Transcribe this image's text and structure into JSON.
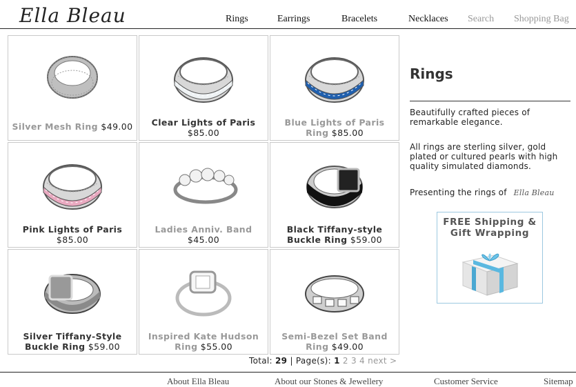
{
  "brand": {
    "logo": "Ella Bleau"
  },
  "nav": {
    "items": [
      "Rings",
      "Earrings",
      "Bracelets",
      "Necklaces"
    ],
    "search": "Search",
    "bag": "Shopping Bag"
  },
  "products": [
    {
      "name": "Silver Mesh Ring",
      "price": "$49.00",
      "style": "mesh",
      "muted": true
    },
    {
      "name": "Clear Lights of Paris",
      "price": "$85.00",
      "style": "clear",
      "muted": false
    },
    {
      "name": "Blue Lights of Paris Ring",
      "price": "$85.00",
      "style": "blue",
      "muted": true
    },
    {
      "name": "Pink Lights of Paris",
      "price": "$85.00",
      "style": "pink",
      "muted": false
    },
    {
      "name": "Ladies Anniv. Band",
      "price": "$45.00",
      "style": "anniv",
      "muted": true
    },
    {
      "name": "Black Tiffany-style Buckle Ring",
      "price": "$59.00",
      "style": "buckle-black",
      "muted": false
    },
    {
      "name": "Silver Tiffany-Style Buckle Ring",
      "price": "$59.00",
      "style": "buckle-silver",
      "muted": false
    },
    {
      "name": "Inspired Kate Hudson Ring",
      "price": "$55.00",
      "style": "solitaire",
      "muted": true
    },
    {
      "name": "Semi-Bezel Set Band Ring",
      "price": "$49.00",
      "style": "bezel",
      "muted": true
    }
  ],
  "pager": {
    "total_label": "Total:",
    "total": "29",
    "pages_label": "| Page(s):",
    "current": "1",
    "others": [
      "2",
      "3",
      "4"
    ],
    "next": "next >"
  },
  "sidebar": {
    "title": "Rings",
    "intro": "Beautifully crafted pieces of remarkable elegance.",
    "detail": "All rings are sterling silver, gold plated or cultured pearls with high quality simulated diamonds.",
    "presenting": "Presenting the rings of",
    "signature": "Ella Bleau",
    "promo": {
      "line1": "FREE Shipping &",
      "line2": "Gift Wrapping",
      "icon": "gift-box-icon"
    }
  },
  "footer": {
    "links": [
      "About Ella Bleau",
      "About our Stones & Jewellery",
      "Customer Service",
      "Sitemap"
    ]
  },
  "colors": {
    "accent_blue": "#1f5fae",
    "ribbon": "#5ab8e0",
    "pink": "#e9a9c0"
  }
}
